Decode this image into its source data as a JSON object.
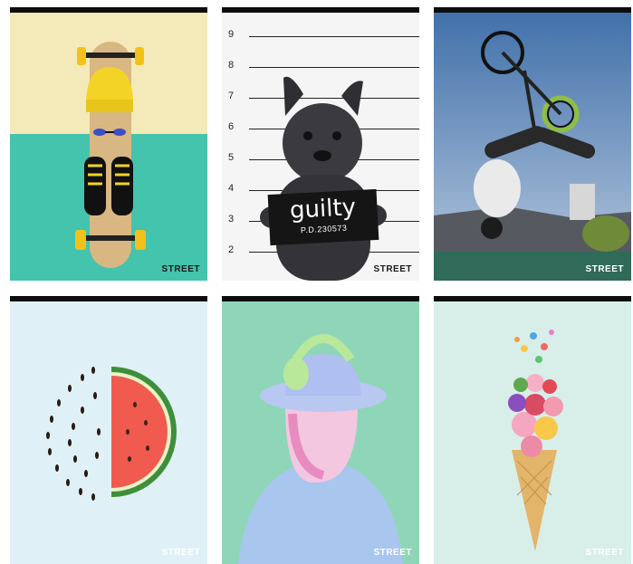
{
  "brand": "STREET",
  "cards": [
    {
      "id": "skateboard"
    },
    {
      "id": "dog-mugshot",
      "sign_text": "guilty",
      "sign_id": "P.D.230573",
      "scale": [
        "9",
        "8",
        "7",
        "6",
        "5",
        "4",
        "3",
        "2"
      ]
    },
    {
      "id": "bmx"
    },
    {
      "id": "watermelon"
    },
    {
      "id": "headphones"
    },
    {
      "id": "flower-cone"
    }
  ],
  "colors": {
    "topbar": "#0d0d0d",
    "skate_top": "#f4e9b8",
    "skate_bottom": "#44c3ad",
    "sky": "#8fb0d6",
    "mint": "#8fd6b8",
    "melon_bg": "#dff1f6",
    "cone_bg": "#d8efe9"
  }
}
